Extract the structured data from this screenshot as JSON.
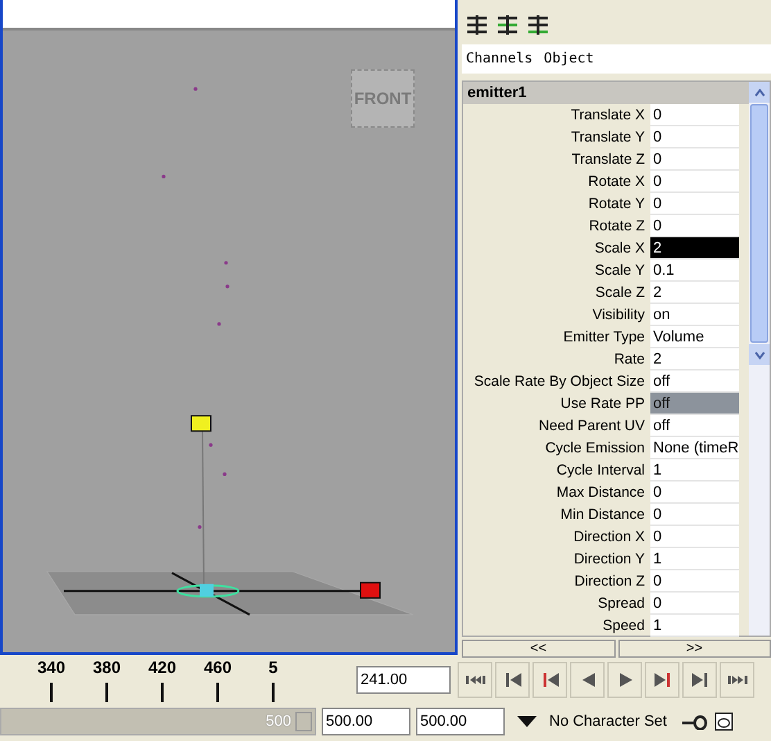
{
  "viewport": {
    "view_cube": "FRONT"
  },
  "channel_box": {
    "menus": [
      {
        "label": "Channels"
      },
      {
        "label": "Object"
      }
    ],
    "node": "emitter1",
    "attributes": [
      {
        "name": "Translate X",
        "value": "0",
        "selected": false,
        "editing": false
      },
      {
        "name": "Translate Y",
        "value": "0",
        "selected": false,
        "editing": false
      },
      {
        "name": "Translate Z",
        "value": "0",
        "selected": false,
        "editing": false
      },
      {
        "name": "Rotate X",
        "value": "0",
        "selected": false,
        "editing": false
      },
      {
        "name": "Rotate Y",
        "value": "0",
        "selected": false,
        "editing": false
      },
      {
        "name": "Rotate Z",
        "value": "0",
        "selected": false,
        "editing": false
      },
      {
        "name": "Scale X",
        "value": "2",
        "selected": false,
        "editing": true
      },
      {
        "name": "Scale Y",
        "value": "0.1",
        "selected": false,
        "editing": false
      },
      {
        "name": "Scale Z",
        "value": "2",
        "selected": false,
        "editing": false
      },
      {
        "name": "Visibility",
        "value": "on",
        "selected": false,
        "editing": false
      },
      {
        "name": "Emitter Type",
        "value": "Volume",
        "selected": false,
        "editing": false
      },
      {
        "name": "Rate",
        "value": "2",
        "selected": false,
        "editing": false
      },
      {
        "name": "Scale Rate By Object Size",
        "value": "off",
        "selected": false,
        "editing": false
      },
      {
        "name": "Use Rate PP",
        "value": "off",
        "selected": true,
        "editing": false
      },
      {
        "name": "Need Parent UV",
        "value": "off",
        "selected": false,
        "editing": false
      },
      {
        "name": "Cycle Emission",
        "value": "None (timeR",
        "selected": false,
        "editing": false
      },
      {
        "name": "Cycle Interval",
        "value": "1",
        "selected": false,
        "editing": false
      },
      {
        "name": "Max Distance",
        "value": "0",
        "selected": false,
        "editing": false
      },
      {
        "name": "Min Distance",
        "value": "0",
        "selected": false,
        "editing": false
      },
      {
        "name": "Direction X",
        "value": "0",
        "selected": false,
        "editing": false
      },
      {
        "name": "Direction Y",
        "value": "1",
        "selected": false,
        "editing": false
      },
      {
        "name": "Direction Z",
        "value": "0",
        "selected": false,
        "editing": false
      },
      {
        "name": "Spread",
        "value": "0",
        "selected": false,
        "editing": false
      },
      {
        "name": "Speed",
        "value": "1",
        "selected": false,
        "editing": false
      }
    ],
    "nav_buttons": [
      "<<",
      ">>"
    ]
  },
  "time_slider": {
    "ticks": [
      "340",
      "380",
      "420",
      "460",
      "5"
    ],
    "current_time": "241.00"
  },
  "range_slider": {
    "level": 1,
    "end_label": "500",
    "start_time": "500.00",
    "end_time": "500.00",
    "character_set": "No Character Set"
  }
}
